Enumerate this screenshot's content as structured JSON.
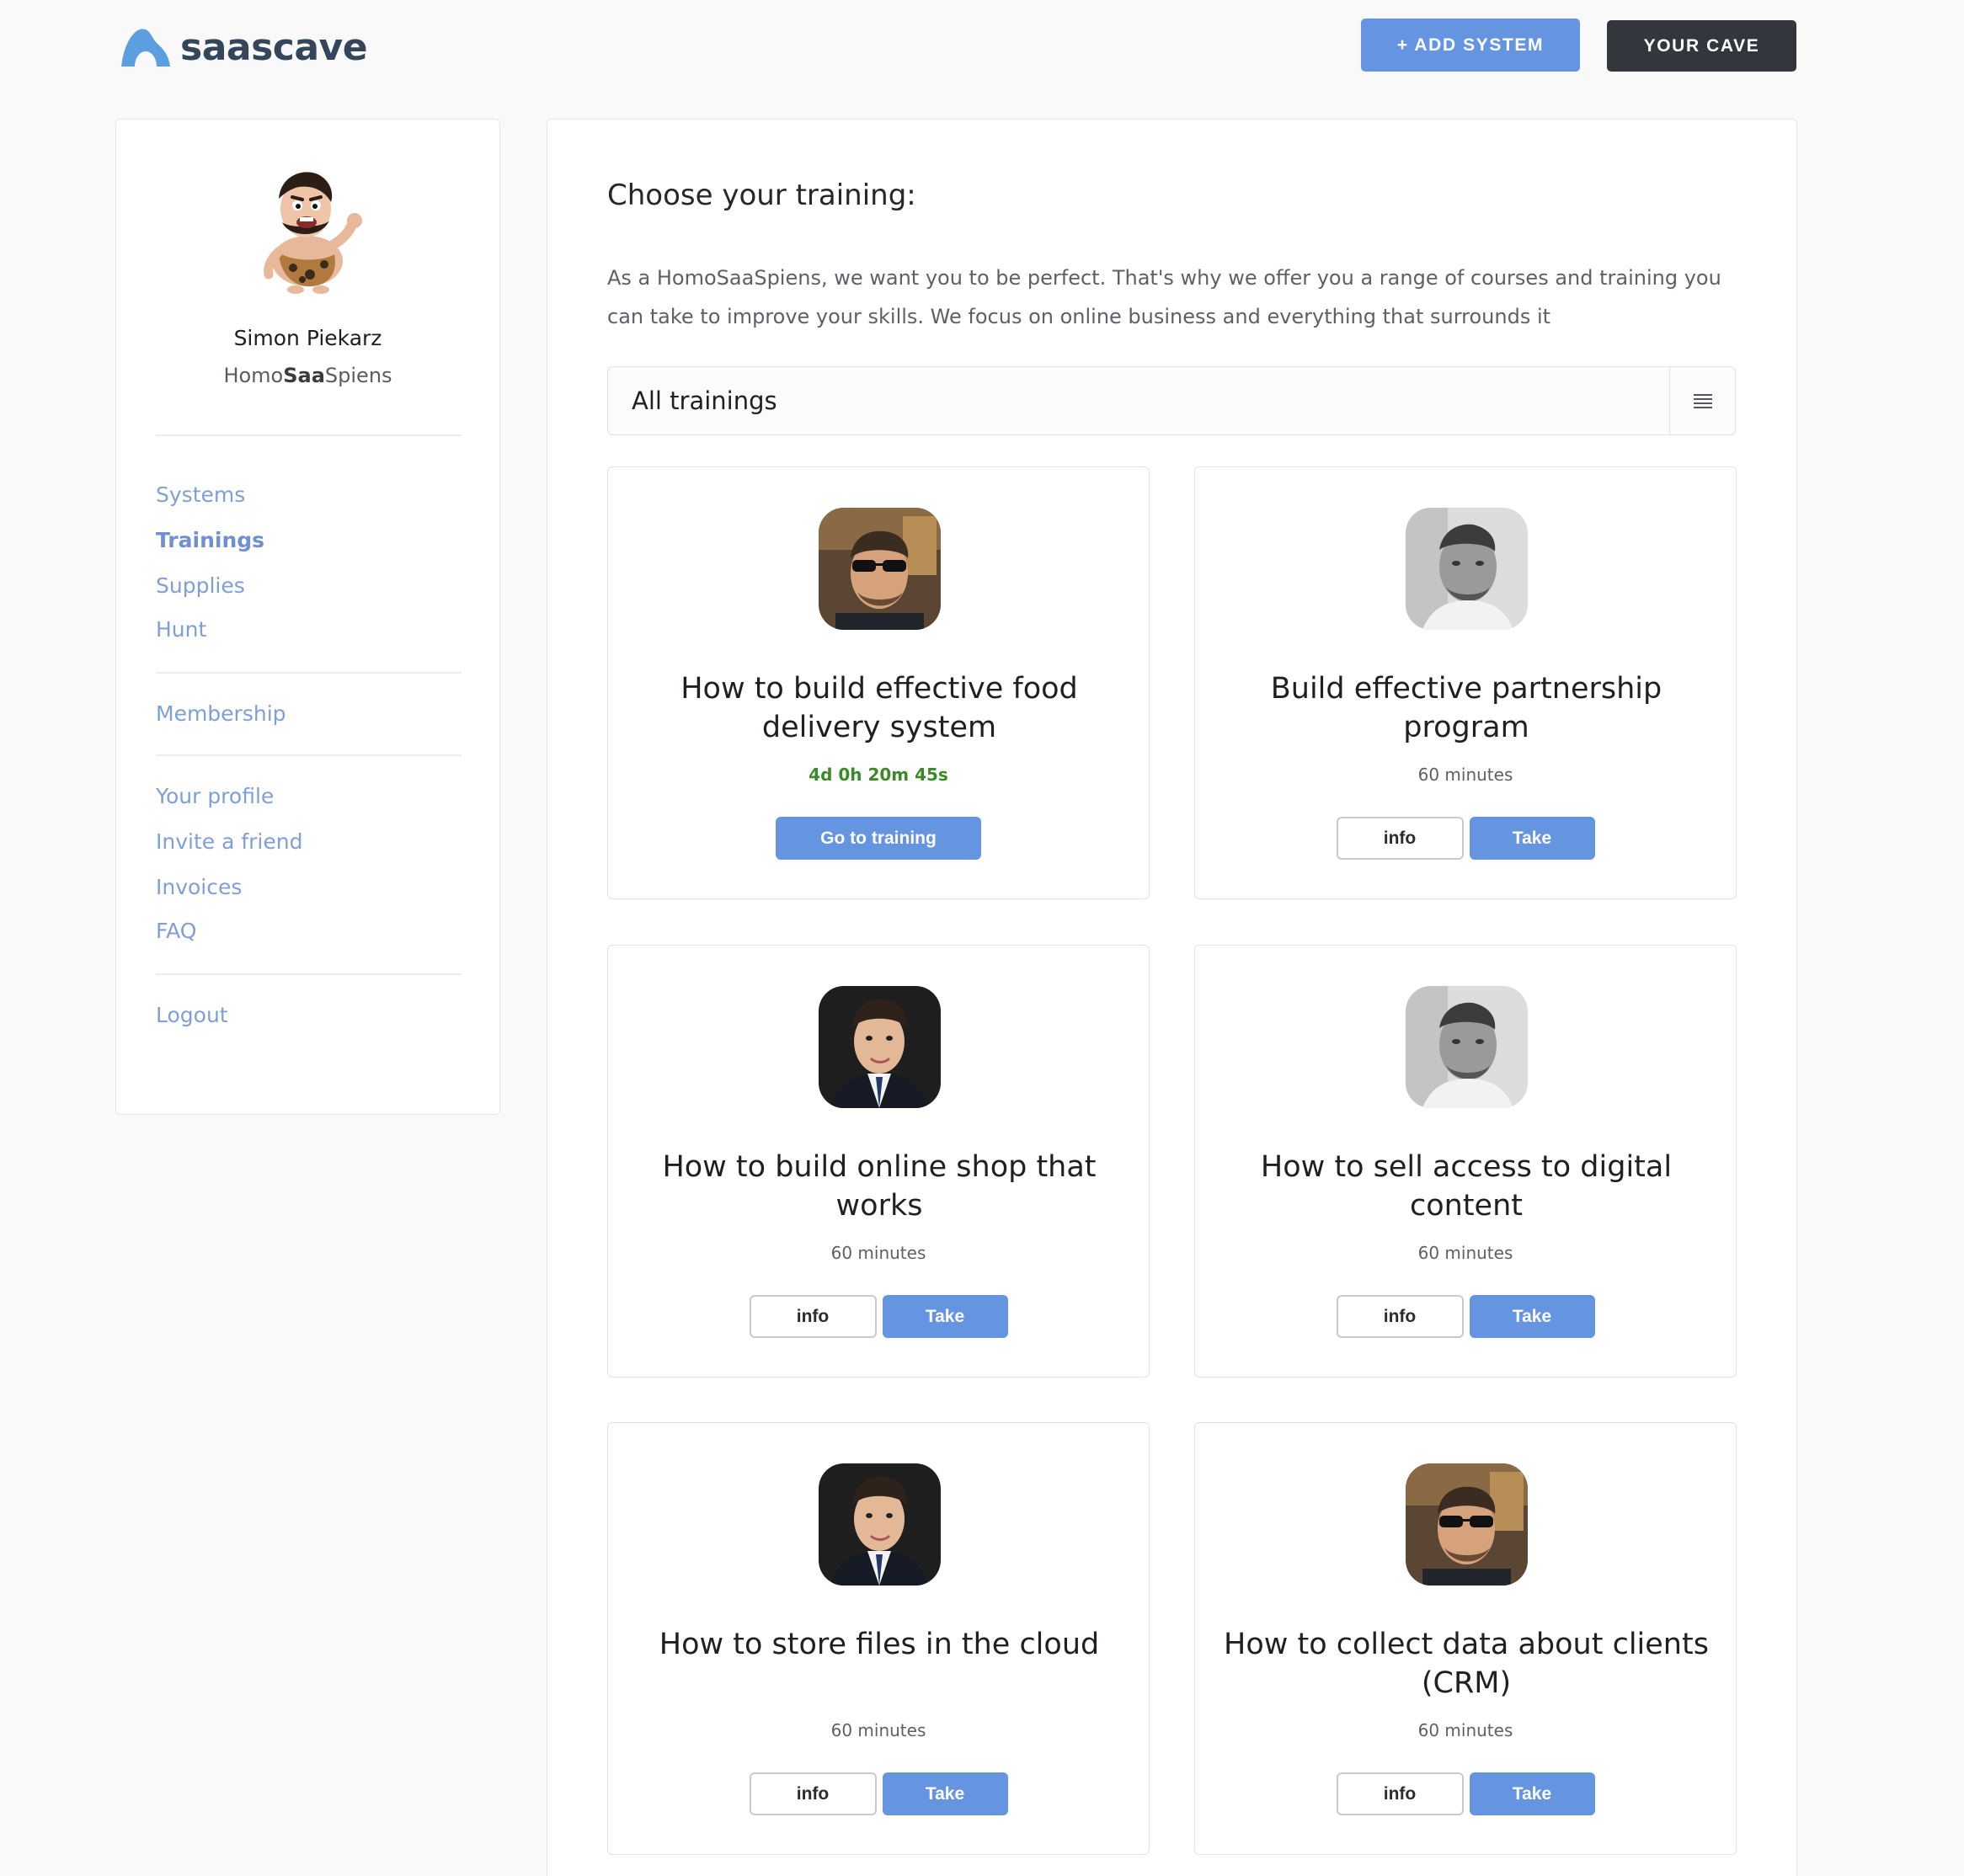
{
  "header": {
    "brand": "saascave",
    "add_system_label": "+ ADD SYSTEM",
    "your_cave_label": "YOUR CAVE",
    "brand_color": "#5b9fe0"
  },
  "sidebar": {
    "user_name": "Simon Piekarz",
    "role_prefix": "Homo",
    "role_bold": "Saa",
    "role_suffix": "Spiens",
    "nav_main": [
      "Systems",
      "Trainings",
      "Supplies",
      "Hunt"
    ],
    "active_item": "Trainings",
    "nav_membership": [
      "Membership"
    ],
    "nav_account": [
      "Your profile",
      "Invite a friend",
      "Invoices",
      "FAQ"
    ],
    "nav_logout": [
      "Logout"
    ]
  },
  "main": {
    "title": "Choose your training:",
    "description": "As a HomoSaaSpiens, we want you to be perfect. That's why we offer you a range of courses and training you can take to improve your skills. We focus on online business and everything that surrounds it",
    "filter_value": "All trainings",
    "filter_icon": "list-icon"
  },
  "trainings": [
    {
      "title": "How to build effective food delivery system",
      "meta": "4d 0h 20m 45s",
      "type": "countdown",
      "primary_label": "Go to training",
      "instructor": "sunglasses"
    },
    {
      "title": "Build effective partnership program",
      "meta": "60 minutes",
      "type": "duration",
      "info_label": "info",
      "take_label": "Take",
      "instructor": "bald"
    },
    {
      "title": "How to build online shop that works",
      "meta": "60 minutes",
      "type": "duration",
      "info_label": "info",
      "take_label": "Take",
      "instructor": "suit"
    },
    {
      "title": "How to sell access to digital content",
      "meta": "60 minutes",
      "type": "duration",
      "info_label": "info",
      "take_label": "Take",
      "instructor": "bald"
    },
    {
      "title": "How to store files in the cloud",
      "meta": "60 minutes",
      "type": "duration",
      "info_label": "info",
      "take_label": "Take",
      "instructor": "suit"
    },
    {
      "title": "How to collect data about clients (CRM)",
      "meta": "60 minutes",
      "type": "duration",
      "info_label": "info",
      "take_label": "Take",
      "instructor": "sunglasses"
    }
  ],
  "colors": {
    "accent": "#6595e0",
    "dark_button": "#33373d",
    "nav_link": "#7f9fd8",
    "countdown": "#3a8a26"
  }
}
